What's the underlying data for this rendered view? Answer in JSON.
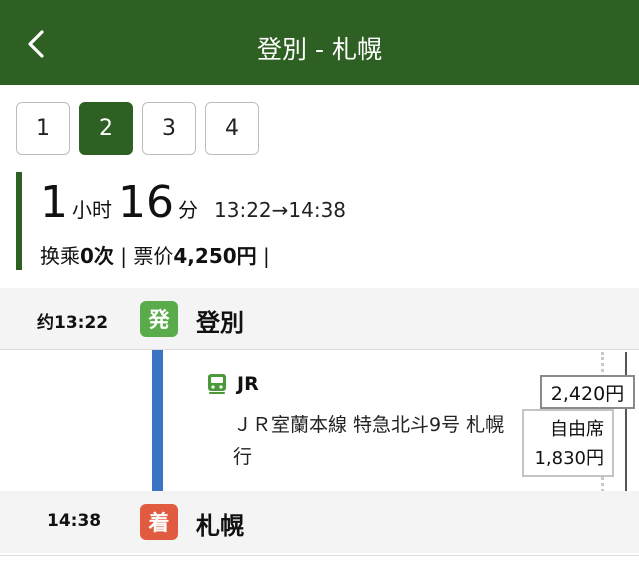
{
  "header": {
    "title": "登別 - 札幌"
  },
  "tabs": [
    {
      "label": "1",
      "active": false
    },
    {
      "label": "2",
      "active": true
    },
    {
      "label": "3",
      "active": false
    },
    {
      "label": "4",
      "active": false
    }
  ],
  "summary": {
    "hours": "1",
    "hours_unit": "小时",
    "minutes": "16",
    "minutes_unit": "分",
    "times": "13:22→14:38",
    "transfer_label": "换乘",
    "transfer_count": "0次",
    "price_label": "票价",
    "price_value": "4,250円",
    "separator": "|"
  },
  "departure": {
    "time": "约13:22",
    "badge": "発",
    "station": "登別"
  },
  "segment": {
    "icon": "train-icon",
    "company": "JR",
    "description": "ＪＲ室蘭本線 特急北斗9号 札幌行",
    "fare": "2,420円",
    "seat_type": "自由席",
    "seat_fare": "1,830円"
  },
  "arrival": {
    "time": "14:38",
    "badge": "着",
    "station": "札幌"
  },
  "colors": {
    "header": "#2d6022",
    "departure_badge": "#5aab4a",
    "arrival_badge": "#e05b3f",
    "route_line": "#3b74c4"
  }
}
